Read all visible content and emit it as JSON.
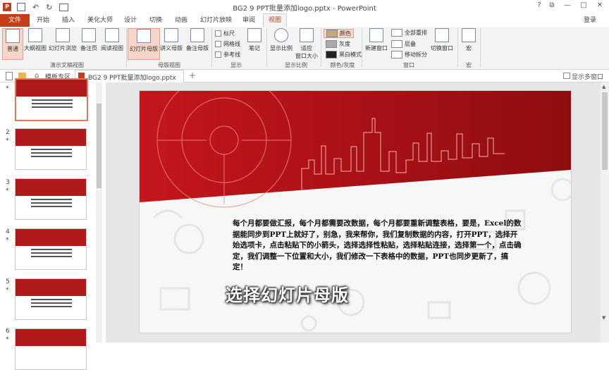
{
  "title": "BG2 9 PPT批量添加logo.pptx - PowerPoint",
  "window": {
    "help": "?",
    "restore": "⧉",
    "minimize": "—",
    "maximize": "□",
    "close": "✕"
  },
  "menu": {
    "file": "文件",
    "tabs": [
      "开始",
      "插入",
      "美化大师",
      "设计",
      "切换",
      "动画",
      "幻灯片放映",
      "审阅",
      "视图"
    ],
    "active": "视图",
    "login": "登录"
  },
  "ribbon": {
    "views": {
      "normal": "普通",
      "outline": "大纲视图",
      "sorter": "幻灯片浏览",
      "notes": "备注页",
      "reading": "阅读视图",
      "group": "演示文稿视图"
    },
    "master": {
      "slide_master": "幻灯片母版",
      "handout_master": "讲义母版",
      "notes_master": "备注母版",
      "group": "母版视图"
    },
    "show": {
      "ruler": "标尺",
      "gridlines": "网格线",
      "guides": "参考线",
      "notes": "笔记",
      "group": "显示"
    },
    "zoom": {
      "zoom": "显示比例",
      "fit": "适应",
      "fit2": "窗口大小",
      "group": "显示比例"
    },
    "color": {
      "color": "颜色",
      "gray": "灰度",
      "bw": "黑白模式",
      "group": "颜色/灰度"
    },
    "window": {
      "new": "新建窗口",
      "arrange": "全部重排",
      "cascade": "层叠",
      "split": "移动拆分",
      "switch": "切换窗口",
      "group": "窗口"
    },
    "macros": {
      "macro": "宏",
      "group": "宏"
    }
  },
  "tabs_bar": {
    "template": "模板专区",
    "doc": "BG2 9 PPT批量添加logo.pptx",
    "more": "显示多窗口"
  },
  "thumbnails": [
    {
      "num": "",
      "star": "*"
    },
    {
      "num": "2",
      "star": "*"
    },
    {
      "num": "3",
      "star": "*"
    },
    {
      "num": "4",
      "star": "*"
    },
    {
      "num": "5",
      "star": "*"
    },
    {
      "num": "6",
      "star": "*"
    }
  ],
  "slide": {
    "body": "每个月都要做汇报，每个月都需要改数据，每个月都要重新调整表格，要是，Excel的数据能同步到PPT上就好了，别急，我来帮你，我们复制数据的内容，打开PPT，选择开始选项卡，点击粘贴下的小箭头，选择选择性粘贴，选择粘贴连接，选择第一个，点击确定，我们调整一下位置和大小，我们修改一下表格中的数据，PPT也同步更新了，搞定！",
    "caption": "选择幻灯片母版"
  },
  "colors": {
    "accent": "#c43e1c",
    "band": "#b11a1a"
  }
}
